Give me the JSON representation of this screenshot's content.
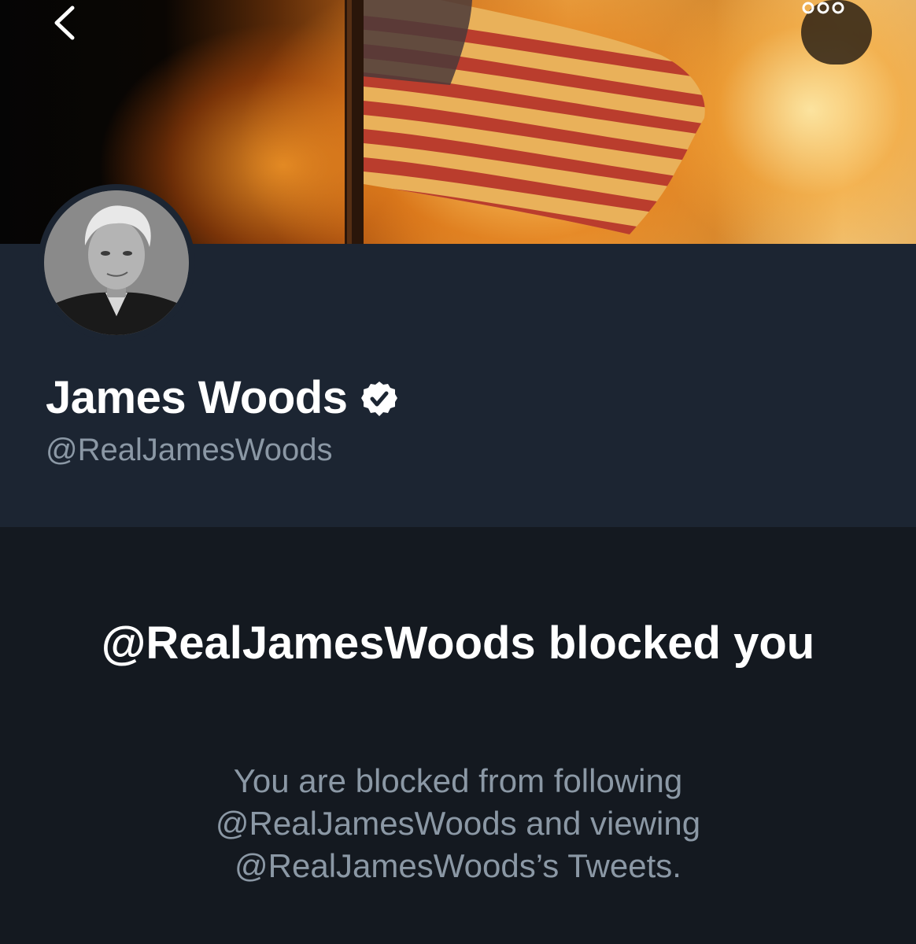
{
  "header": {
    "back_icon": "chevron-left-icon",
    "more_icon": "more-horizontal-icon",
    "banner_image": "burning-american-flag"
  },
  "profile": {
    "display_name": "James Woods",
    "verified": true,
    "verified_icon": "verified-badge-icon",
    "handle": "@RealJamesWoods",
    "avatar": "profile-photo"
  },
  "blocked_notice": {
    "title": "@RealJamesWoods blocked you",
    "message": "You are blocked from following @RealJamesWoods and viewing @RealJamesWoods’s Tweets."
  },
  "colors": {
    "background": "#141920",
    "info_band": "#1c2532",
    "primary_text": "#ffffff",
    "secondary_text": "#8b98a5"
  }
}
